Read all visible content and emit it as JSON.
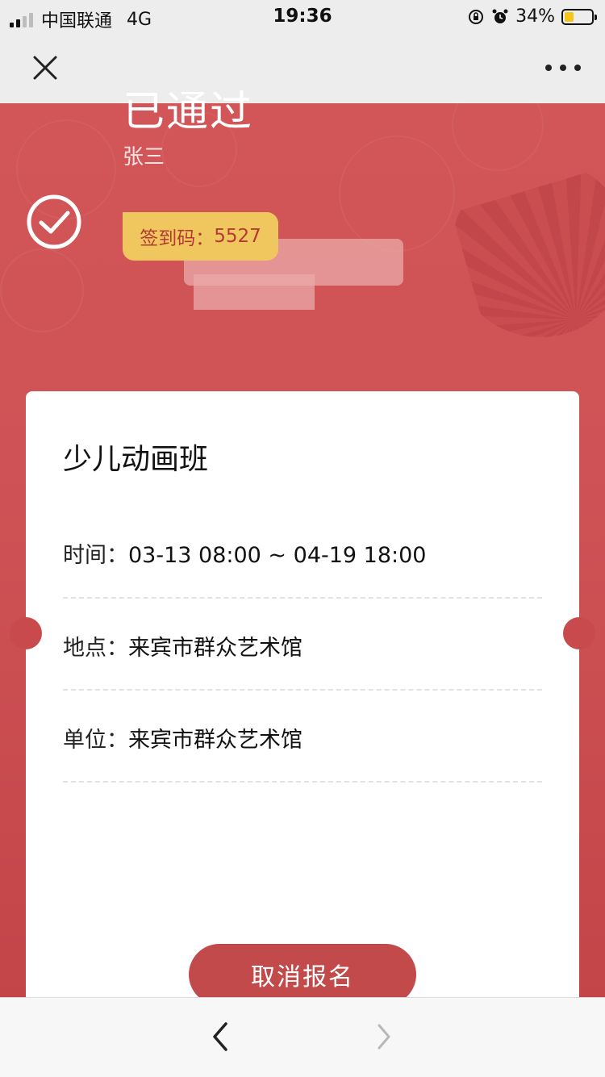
{
  "status_bar": {
    "carrier": "中国联通",
    "network": "4G",
    "time": "19:36",
    "battery": "34%"
  },
  "header": {
    "status_title": "已通过",
    "user_name": "张三",
    "checkin_label": "签到码：",
    "checkin_code": "5527"
  },
  "course": {
    "title": "少儿动画班",
    "rows": [
      {
        "label": "时间：",
        "value": "03-13 08:00 ~ 04-19 18:00"
      },
      {
        "label": "地点：",
        "value": "来宾市群众艺术馆"
      },
      {
        "label": "单位：",
        "value": "来宾市群众艺术馆"
      }
    ]
  },
  "actions": {
    "cancel_label": "取消报名"
  },
  "colors": {
    "accent_red": "#d25557",
    "badge_yellow": "#f0c75e",
    "button_red": "#c24a4a"
  }
}
